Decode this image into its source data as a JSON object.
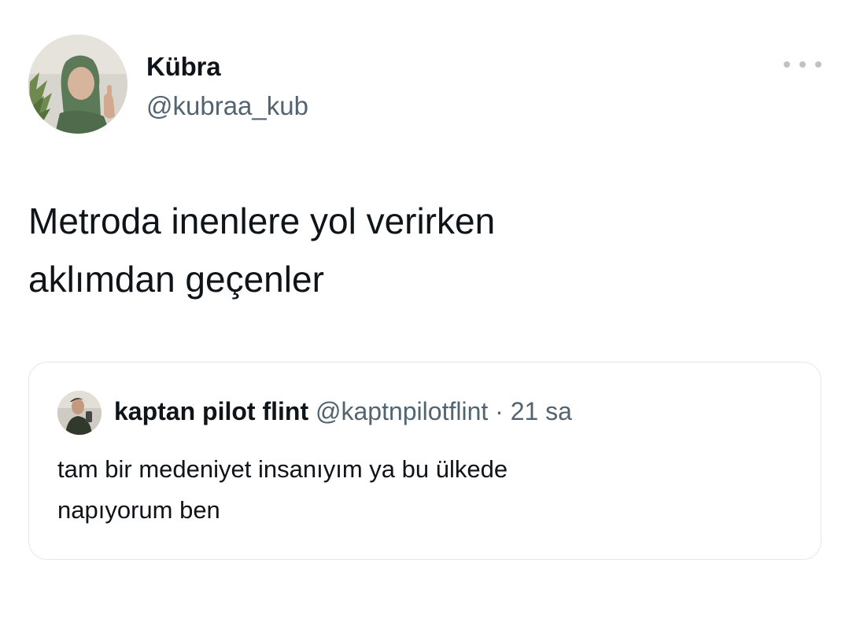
{
  "author": {
    "display_name": "Kübra",
    "handle": "@kubraa_kub"
  },
  "tweet": {
    "text_line1": "Metroda inenlere yol verirken",
    "text_line2": "aklımdan geçenler"
  },
  "quoted_tweet": {
    "display_name": "kaptan pilot flint",
    "handle": "@kaptnpilotflint",
    "separator": "·",
    "time": "21 sa",
    "text_line1": "tam bir medeniyet insanıyım ya bu ülkede",
    "text_line2": "napıyorum ben"
  },
  "icons": {
    "more": "more-horizontal-icon"
  },
  "colors": {
    "text_primary": "#0f1419",
    "text_secondary": "#536471",
    "border": "#e4e8eb"
  }
}
